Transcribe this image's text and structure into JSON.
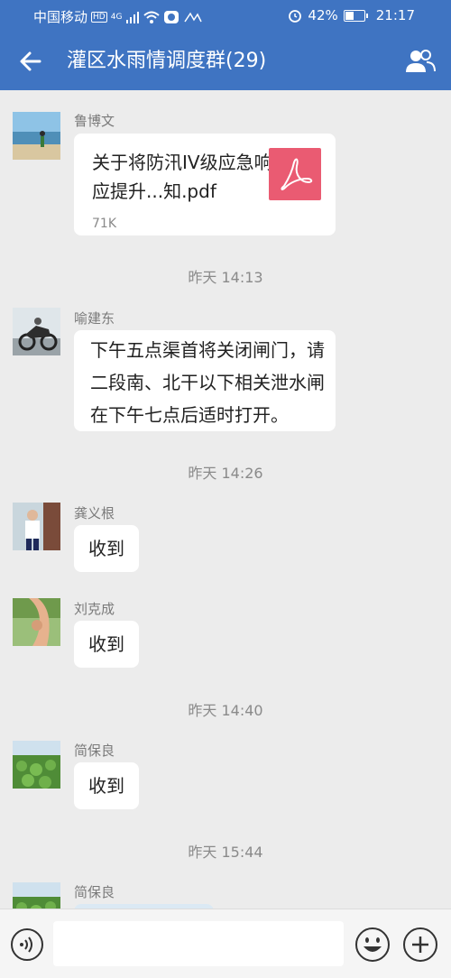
{
  "status_bar": {
    "carrier": "中国移动",
    "hd": "HD",
    "signal": "4G",
    "battery": "42%",
    "battery_level": 0.42,
    "time": "21:17"
  },
  "header": {
    "title": "灌区水雨情调度群(29)"
  },
  "messages": [
    {
      "sender": "鲁博文",
      "file": {
        "name": "关于将防汛IV级应急响应提升...知.pdf",
        "size": "71K"
      }
    },
    {
      "timestamp": "昨天  14:13"
    },
    {
      "sender": "喻建东",
      "text": [
        "下午五点渠首将关闭闸门，请",
        "二段南、北干以下相关泄水闸",
        "在下午七点后适时打开。"
      ]
    },
    {
      "timestamp": "昨天  14:26"
    },
    {
      "sender": "龚义根",
      "text": "收到"
    },
    {
      "sender": "刘克成",
      "text": "收到"
    },
    {
      "timestamp": "昨天  14:40"
    },
    {
      "sender": "简保良",
      "text": "收到"
    },
    {
      "timestamp": "昨天  15:44"
    },
    {
      "sender": "简保良"
    }
  ]
}
